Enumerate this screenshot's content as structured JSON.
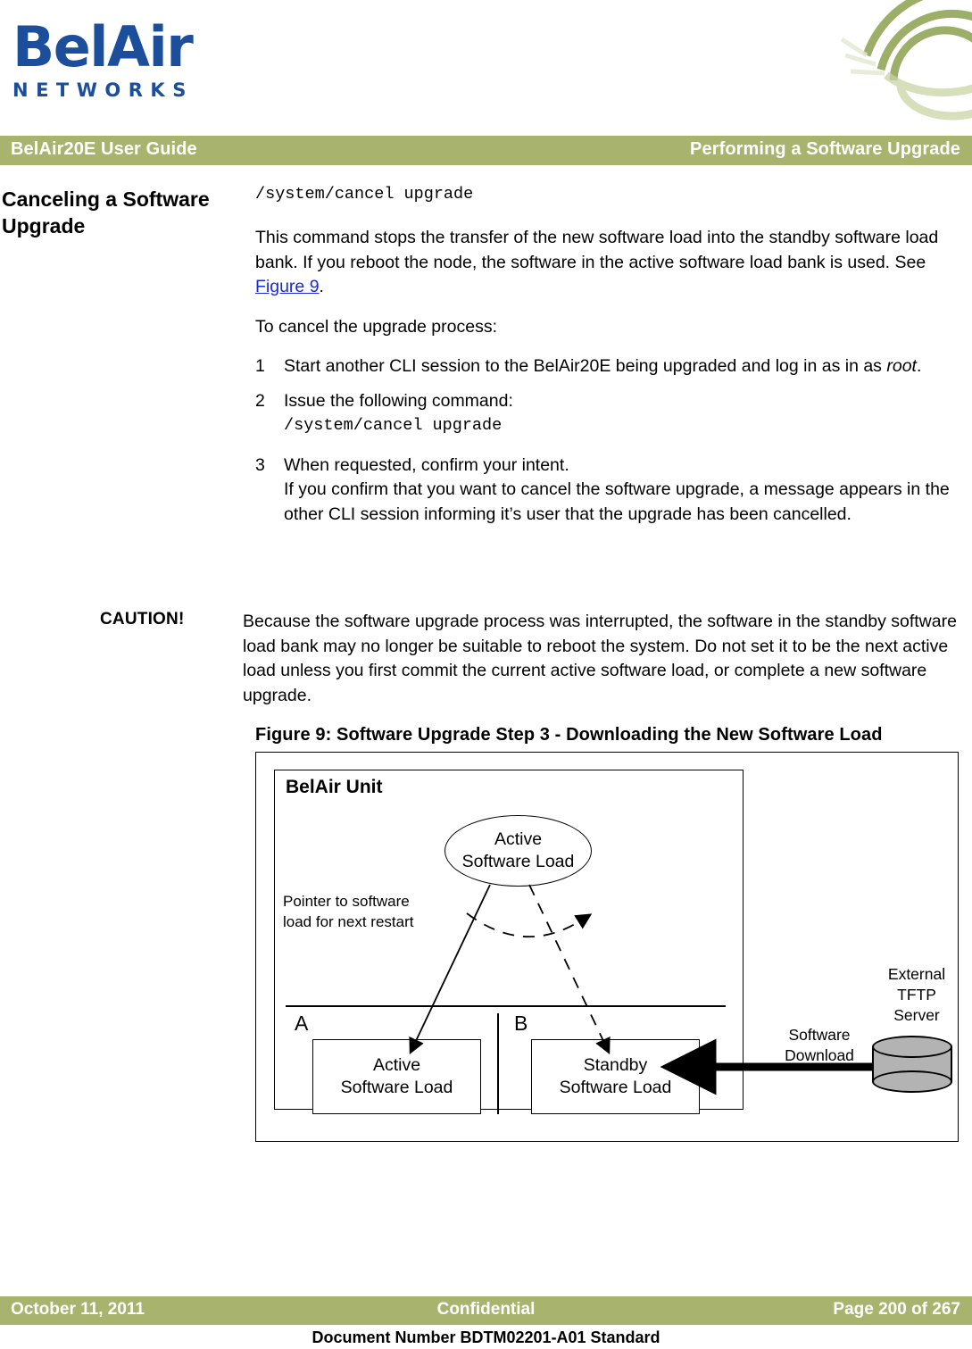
{
  "logo": {
    "wordmark": "BelAir",
    "subtext": "NETWORKS",
    "brand_color": "#1b4f9c"
  },
  "header": {
    "title": "BelAir20E User Guide",
    "chapter": "Performing a Software Upgrade",
    "band_color": "#a8b46d"
  },
  "section": {
    "side_heading": "Canceling a Software Upgrade",
    "command_top": "/system/cancel upgrade",
    "intro_before_link": "This command stops the transfer of the new software load into the standby software load bank. If you reboot the node, the software in the active software load bank is used. See ",
    "intro_link": "Figure 9",
    "intro_after_link": ".",
    "lead_in": "To cancel the upgrade process:",
    "steps": [
      {
        "num": "1",
        "text_before_italic": "Start another CLI session to the BelAir20E being upgraded and log in as in as ",
        "italic": "root",
        "text_after_italic": "."
      },
      {
        "num": "2",
        "text": "Issue the following command:",
        "command": "/system/cancel upgrade"
      },
      {
        "num": "3",
        "text": "When requested, confirm your intent.",
        "continuation": "If you confirm that you want to cancel the software upgrade, a message appears in the other CLI session informing it’s user that the upgrade has been cancelled."
      }
    ]
  },
  "caution": {
    "label": "CAUTION!",
    "text": "Because the software upgrade process was interrupted, the software in the standby software load bank may no longer be suitable to reboot the system. Do not set it to be the next active load unless you first commit the current active software load, or complete a new software upgrade."
  },
  "figure": {
    "caption": "Figure 9: Software Upgrade Step 3 - Downloading the New Software Load",
    "unit_label": "BelAir Unit",
    "active_ellipse": {
      "line1": "Active",
      "line2": "Software Load"
    },
    "pointer_note": {
      "line1": "Pointer to software",
      "line2": "load for next restart"
    },
    "bank_a_letter": "A",
    "bank_b_letter": "B",
    "active_load_box": {
      "line1": "Active",
      "line2": "Software Load"
    },
    "standby_load_box": {
      "line1": "Standby",
      "line2": "Software Load"
    },
    "tftp_label": {
      "line1": "External",
      "line2": "TFTP",
      "line3": "Server"
    },
    "download_label": {
      "line1": "Software",
      "line2": "Download"
    },
    "cylinder_color": "#b3b3b3"
  },
  "footer": {
    "date": "October 11, 2011",
    "confidential": "Confidential",
    "page": "Page 200 of 267",
    "doc_number": "Document Number BDTM02201-A01 Standard"
  }
}
